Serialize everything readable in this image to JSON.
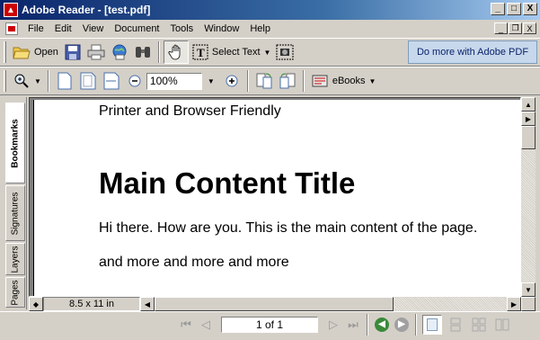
{
  "window": {
    "title": "Adobe Reader - [test.pdf]",
    "controls": {
      "minimize": "_",
      "maximize": "□",
      "close": "X"
    }
  },
  "menubar": {
    "items": [
      "File",
      "Edit",
      "View",
      "Document",
      "Tools",
      "Window",
      "Help"
    ],
    "mdi_controls": {
      "minimize": "_",
      "restore": "❐",
      "close": "X"
    }
  },
  "toolbar1": {
    "open_label": "Open",
    "select_text_label": "Select Text",
    "promo_label": "Do more with Adobe PDF"
  },
  "toolbar2": {
    "zoom_value": "100%",
    "ebooks_label": "eBooks"
  },
  "navpane": {
    "tabs": [
      "Bookmarks",
      "Signatures",
      "Layers",
      "Pages"
    ]
  },
  "document": {
    "header": "Printer and Browser Friendly",
    "title": "Main Content Title",
    "paragraph1": "Hi there. How are you. This is the main content of the page.",
    "paragraph2": "and more and more and more"
  },
  "hscroll": {
    "page_size": "8.5 x 11 in"
  },
  "statusbar": {
    "page_indicator": "1 of 1"
  }
}
